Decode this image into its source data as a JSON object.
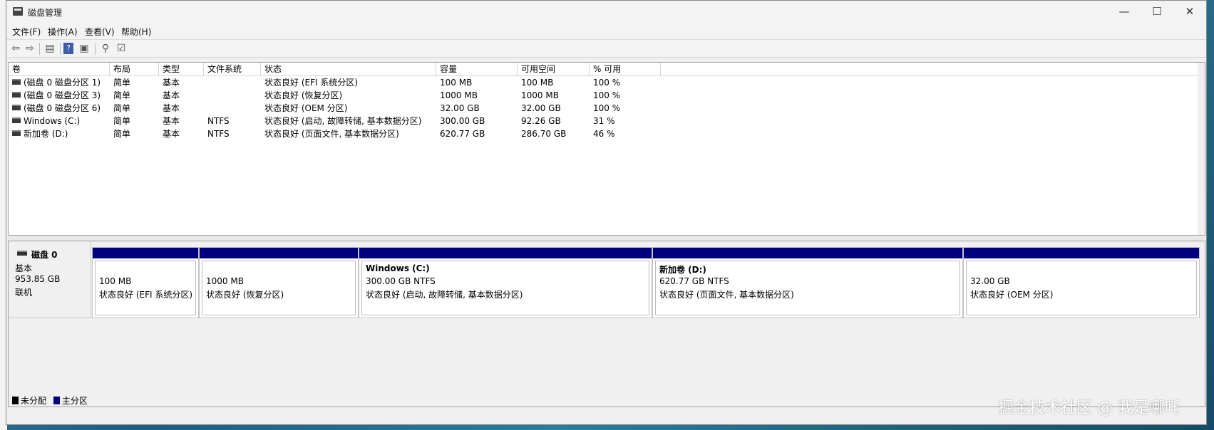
{
  "window": {
    "title": "磁盘管理",
    "min_glyph": "—",
    "max_glyph": "☐",
    "close_glyph": "✕"
  },
  "menu": [
    "文件(F)",
    "操作(A)",
    "查看(V)",
    "帮助(H)"
  ],
  "toolbar_icons": [
    "back-icon",
    "forward-icon",
    "properties-icon",
    "help-icon",
    "console-view-icon",
    "connect-icon",
    "settings-icon"
  ],
  "volume_table": {
    "columns": [
      "卷",
      "布局",
      "类型",
      "文件系统",
      "状态",
      "容量",
      "可用空间",
      "% 可用"
    ],
    "rows": [
      [
        "(磁盘 0 磁盘分区 1)",
        "简单",
        "基本",
        "",
        "状态良好 (EFI 系统分区)",
        "100 MB",
        "100 MB",
        "100 %"
      ],
      [
        "(磁盘 0 磁盘分区 3)",
        "简单",
        "基本",
        "",
        "状态良好 (恢复分区)",
        "1000 MB",
        "1000 MB",
        "100 %"
      ],
      [
        "(磁盘 0 磁盘分区 6)",
        "简单",
        "基本",
        "",
        "状态良好 (OEM 分区)",
        "32.00 GB",
        "32.00 GB",
        "100 %"
      ],
      [
        "Windows (C:)",
        "简单",
        "基本",
        "NTFS",
        "状态良好 (启动, 故障转储, 基本数据分区)",
        "300.00 GB",
        "92.26 GB",
        "31 %"
      ],
      [
        "新加卷 (D:)",
        "简单",
        "基本",
        "NTFS",
        "状态良好 (页面文件, 基本数据分区)",
        "620.77 GB",
        "286.70 GB",
        "46 %"
      ]
    ]
  },
  "disk": {
    "name": "磁盘 0",
    "type": "基本",
    "size": "953.85 GB",
    "status": "联机",
    "partitions": [
      {
        "name": "",
        "size": "100 MB",
        "status": "状态良好 (EFI 系统分区)"
      },
      {
        "name": "",
        "size": "1000 MB",
        "status": "状态良好 (恢复分区)"
      },
      {
        "name": "Windows  (C:)",
        "size": "300.00 GB NTFS",
        "status": "状态良好 (启动, 故障转储, 基本数据分区)"
      },
      {
        "name": "新加卷  (D:)",
        "size": "620.77 GB NTFS",
        "status": "状态良好 (页面文件, 基本数据分区)"
      },
      {
        "name": "",
        "size": "32.00 GB",
        "status": "状态良好 (OEM 分区)"
      }
    ]
  },
  "legend": {
    "unallocated": "未分配",
    "primary": "主分区",
    "unallocated_color": "#000000",
    "primary_color": "#00007f"
  },
  "watermark": "掘金技术社区 @ 我是哪吒"
}
